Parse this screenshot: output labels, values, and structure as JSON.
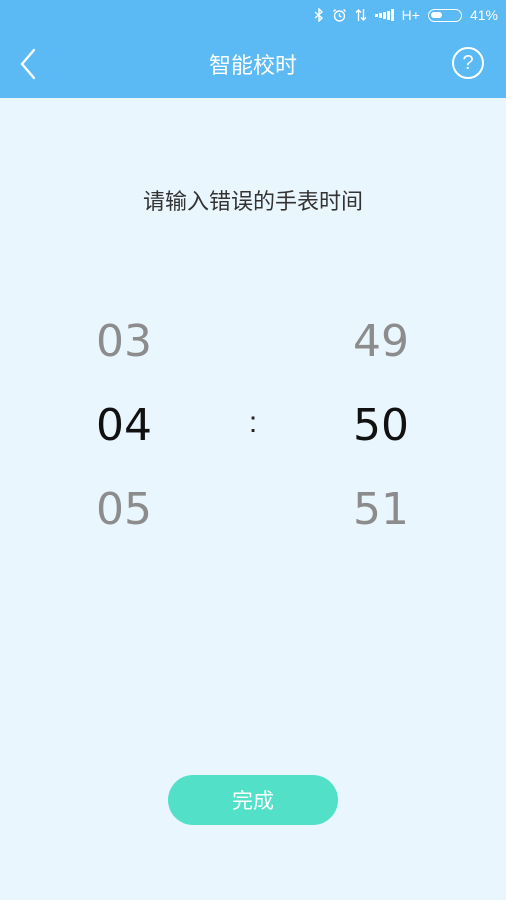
{
  "status_bar": {
    "network": "H+",
    "battery_text": "41%",
    "battery_level": 0.41,
    "icons": [
      "bluetooth-icon",
      "alarm-icon",
      "data-transfer-icon",
      "signal-icon",
      "battery-icon"
    ]
  },
  "header": {
    "title": "智能校时",
    "back_icon": "chevron-left-icon",
    "help_label": "?"
  },
  "prompt": "请输入错误的手表时间",
  "picker": {
    "hours": {
      "prev": "03",
      "selected": "04",
      "next": "05"
    },
    "separator": ":",
    "minutes": {
      "prev": "49",
      "selected": "50",
      "next": "51"
    }
  },
  "done_button": "完成",
  "colors": {
    "header_bg": "#5bb9f4",
    "page_bg": "#eaf6fd",
    "button_bg": "#52e0c8"
  }
}
